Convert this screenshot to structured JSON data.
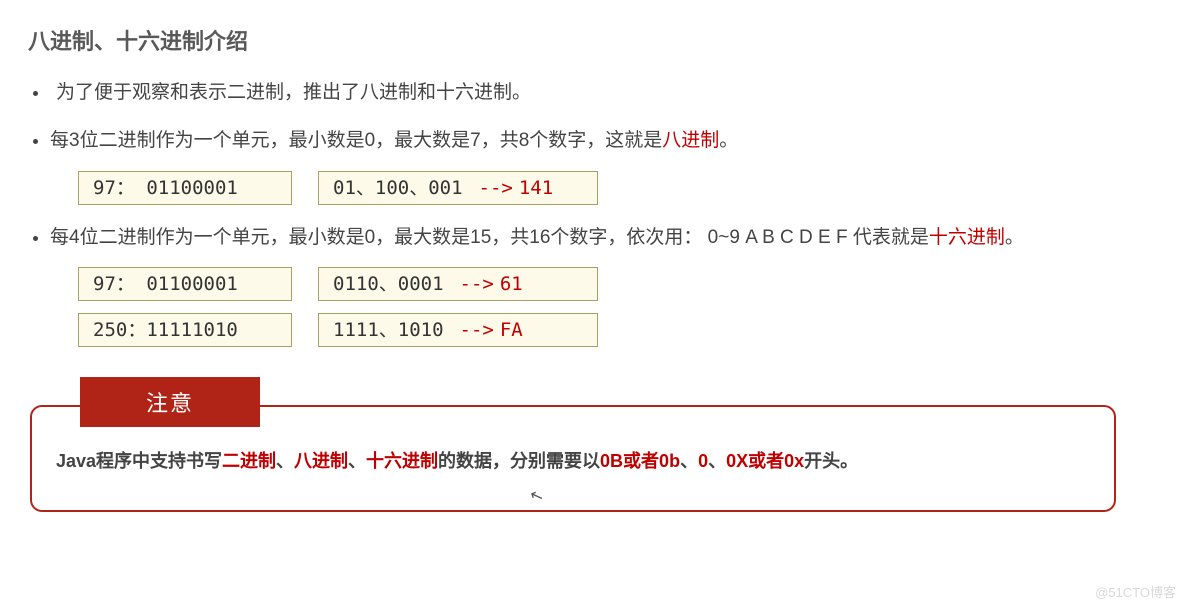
{
  "heading": "八进制、十六进制介绍",
  "bullets": {
    "b1": "为了便于观察和表示二进制，推出了八进制和十六进制。",
    "b2_pre": "每3位二进制作为一个单元，最小数是0，最大数是7，共8个数字，这就是",
    "b2_red": "八进制",
    "b2_post": "。",
    "b3_pre": "每4位二进制作为一个单元，最小数是0，最大数是15，共16个数字，依次用：  0~9 A B C D E F  代表就是",
    "b3_red": "十六进制",
    "b3_post": "。"
  },
  "octal_row": {
    "left": "97： 01100001",
    "right_core": "01、100、001",
    "arrow": "-->",
    "result": "141"
  },
  "hex_rows": [
    {
      "left": "97： 01100001",
      "right_core": "0110、0001",
      "arrow": "-->",
      "result": "61"
    },
    {
      "left": "250：11111010",
      "right_core": "1111、1010",
      "arrow": "-->",
      "result": "FA"
    }
  ],
  "notice": {
    "badge": "注意",
    "t0": "Java程序中支持书写",
    "t1": "二进制",
    "t2": "、",
    "t3": "八进制",
    "t4": "、",
    "t5": "十六进制",
    "t6": "的数据，分别需要以",
    "t7": "0B或者0b",
    "t8": "、",
    "t9": "0",
    "t10": "、",
    "t11": "0X或者0x",
    "t12": "开头。"
  },
  "watermark": "@51CTO博客"
}
